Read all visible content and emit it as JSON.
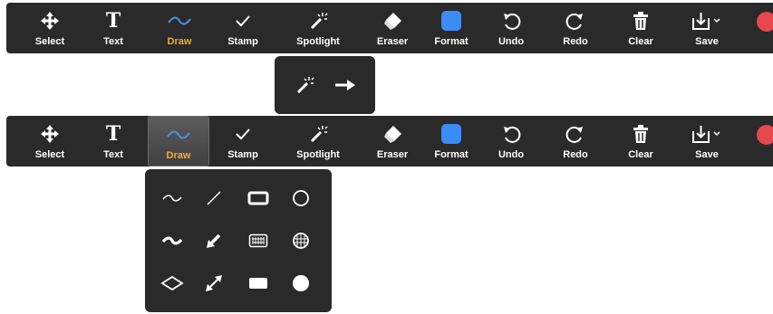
{
  "toolbar_top": {
    "select": "Select",
    "text": "Text",
    "draw": "Draw",
    "stamp": "Stamp",
    "spotlight": "Spotlight",
    "eraser": "Eraser",
    "format": "Format",
    "undo": "Undo",
    "redo": "Redo",
    "clear": "Clear",
    "save": "Save"
  },
  "toolbar_bottom": {
    "select": "Select",
    "text": "Text",
    "draw": "Draw",
    "stamp": "Stamp",
    "spotlight": "Spotlight",
    "eraser": "Eraser",
    "format": "Format",
    "undo": "Undo",
    "redo": "Redo",
    "clear": "Clear",
    "save": "Save"
  },
  "icons": {
    "text_glyph": "T",
    "stamp_glyph": "✓"
  },
  "spotlight_popup": {
    "items": [
      "spotlight-wand-icon",
      "arrow-right-icon"
    ]
  },
  "draw_popup": {
    "items": [
      "thin-freehand-icon",
      "thin-line-icon",
      "rectangle-outline-icon",
      "ellipse-outline-icon",
      "thick-freehand-icon",
      "thick-arrow-line-icon",
      "rectangle-hatched-icon",
      "ellipse-hatched-icon",
      "diamond-outline-icon",
      "double-arrow-icon",
      "rectangle-filled-icon",
      "ellipse-filled-icon"
    ]
  },
  "colors": {
    "toolbar_bg": "#2a2a2a",
    "active_label": "#f2a93b",
    "draw_icon": "#4a90e2",
    "format_swatch": "#3b8cf5",
    "close_red": "#e5484d"
  }
}
